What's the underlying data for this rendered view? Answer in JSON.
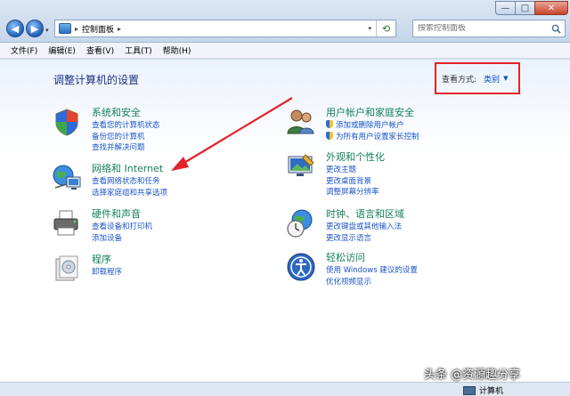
{
  "window": {
    "minimize_glyph": "—",
    "maximize_glyph": "□",
    "close_glyph": "✕"
  },
  "navigation": {
    "back_glyph": "◀",
    "forward_glyph": "▶",
    "history_glyph": "▾",
    "breadcrumb_sep": "▸",
    "breadcrumb": "控制面板",
    "address_drop_glyph": "▾",
    "refresh_glyph": "⟲"
  },
  "search": {
    "placeholder": "搜索控制面板"
  },
  "menu": [
    "文件(F)",
    "编辑(E)",
    "查看(V)",
    "工具(T)",
    "帮助(H)"
  ],
  "content": {
    "title": "调整计算机的设置",
    "viewby_label": "查看方式:",
    "viewby_value": "类别",
    "viewby_arrow": "▼"
  },
  "categories": [
    {
      "title": "系统和安全",
      "icon": "shield-icon",
      "links": [
        "查看您的计算机状态",
        "备份您的计算机",
        "查找并解决问题"
      ]
    },
    {
      "title": "网络和 Internet",
      "icon": "network-icon",
      "links": [
        "查看网络状态和任务",
        "选择家庭组和共享选项"
      ]
    },
    {
      "title": "硬件和声音",
      "icon": "printer-icon",
      "links": [
        "查看设备和打印机",
        "添加设备"
      ]
    },
    {
      "title": "程序",
      "icon": "programs-icon",
      "links": [
        "卸载程序"
      ]
    },
    {
      "title": "用户帐户和家庭安全",
      "icon": "users-icon",
      "links": [
        "添加或删除用户帐户",
        "为所有用户设置家长控制"
      ]
    },
    {
      "title": "外观和个性化",
      "icon": "appearance-icon",
      "links": [
        "更改主题",
        "更改桌面背景",
        "调整屏幕分辨率"
      ]
    },
    {
      "title": "时钟、语言和区域",
      "icon": "clock-globe-icon",
      "links": [
        "更改键盘或其他输入法",
        "更改显示语言"
      ]
    },
    {
      "title": "轻松访问",
      "icon": "accessibility-icon",
      "links": [
        "使用 Windows 建议的设置",
        "优化视频显示"
      ]
    }
  ],
  "statusbar": {
    "computer_label": "计算机"
  },
  "watermark": "头条 @资源趣分享",
  "colors": {
    "category_title": "#13805b",
    "link": "#1a54c9",
    "highlight_box": "#e2232a",
    "arrow": "#e2232a"
  }
}
